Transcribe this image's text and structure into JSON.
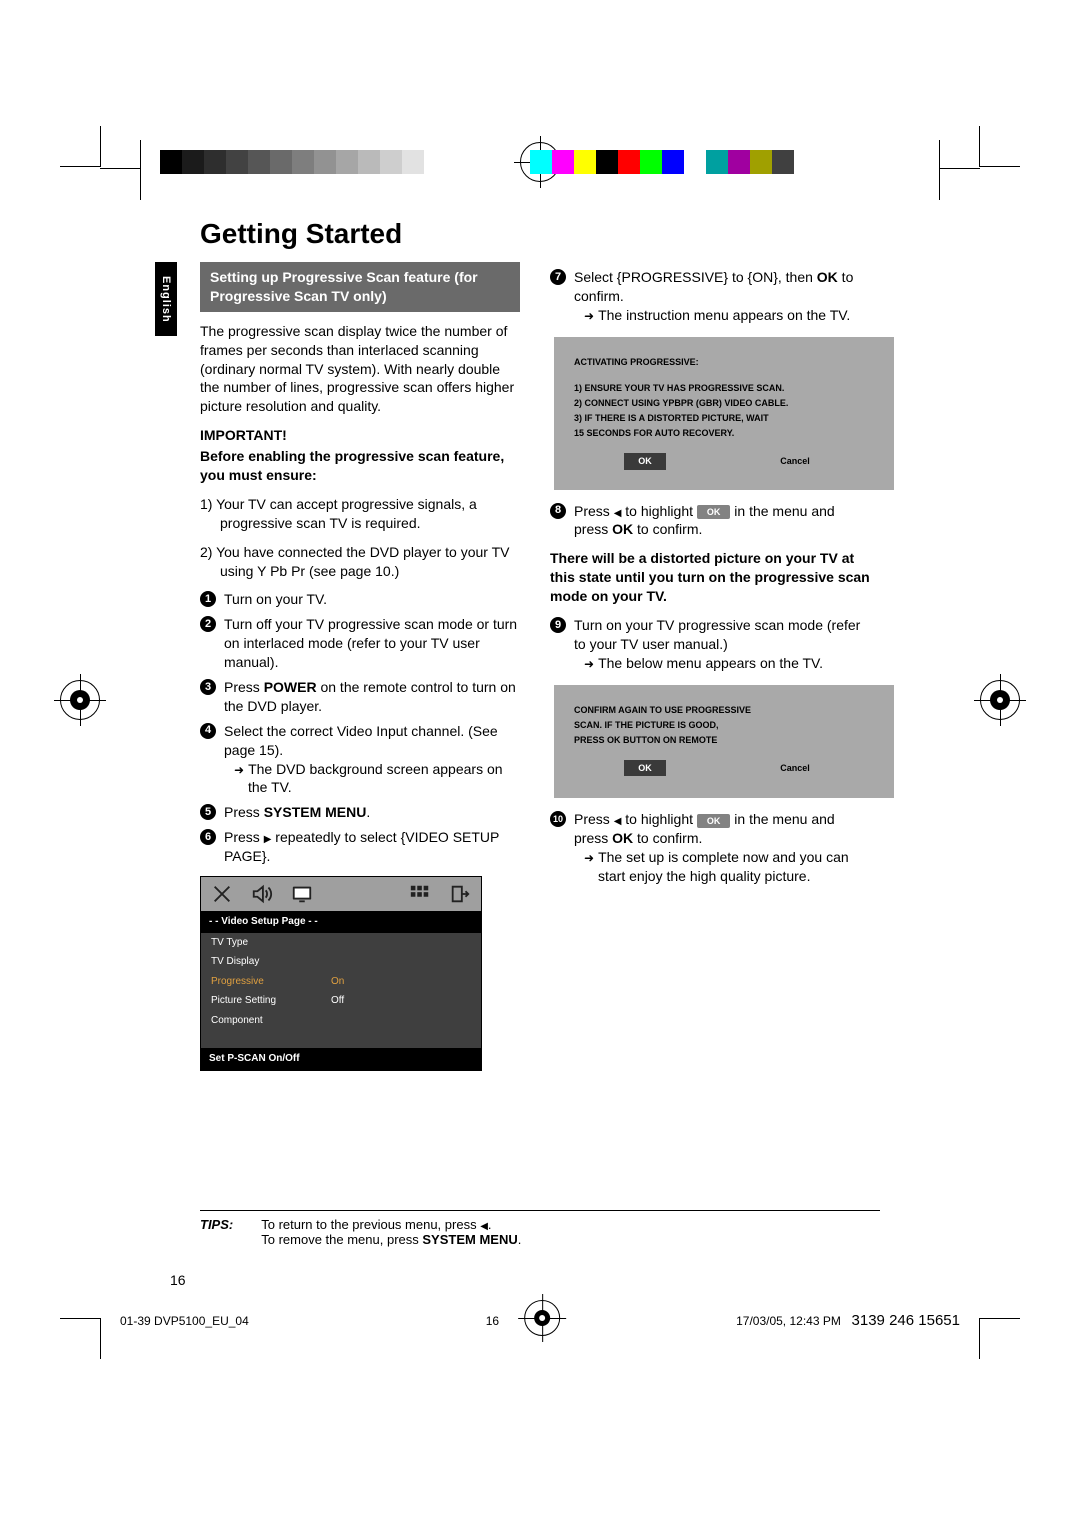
{
  "lang_tab": "English",
  "title": "Getting Started",
  "section_header": "Setting up Progressive Scan feature (for Progressive Scan TV only)",
  "intro": "The progressive scan display twice the number of frames per seconds than interlaced scanning (ordinary normal TV system). With nearly double the number of lines, progressive scan offers higher picture resolution and quality.",
  "important_label": "IMPORTANT!",
  "important_body": "Before enabling the progressive scan feature, you must ensure:",
  "ensure_1": "1) Your TV can accept progressive signals, a progressive scan TV is required.",
  "ensure_2": "2) You have connected the DVD player to your TV using Y Pb Pr (see page 10.)",
  "steps_left": {
    "s1": "Turn on your TV.",
    "s2": "Turn off your TV progressive scan mode or turn on interlaced mode (refer to your TV user manual).",
    "s3_a": "Press ",
    "s3_b": "POWER",
    "s3_c": " on the remote control to turn on the DVD player.",
    "s4_a": "Select the correct Video Input channel. (See page 15).",
    "s4_arrow": "The DVD background screen appears on the TV.",
    "s5_a": "Press ",
    "s5_b": "SYSTEM MENU",
    "s5_c": ".",
    "s6_a": "Press ",
    "s6_b": " repeatedly to select {VIDEO SETUP PAGE}."
  },
  "osd": {
    "title": "- -   Video Setup Page   - -",
    "rows": [
      {
        "label": "TV Type",
        "value": ""
      },
      {
        "label": "TV Display",
        "value": ""
      },
      {
        "label": "Progressive",
        "value": "On",
        "hl": true
      },
      {
        "label": "Picture Setting",
        "value": "Off"
      },
      {
        "label": "Component",
        "value": ""
      }
    ],
    "footer": "Set P-SCAN On/Off"
  },
  "steps_right": {
    "s7_a": "Select {PROGRESSIVE} to {ON}, then ",
    "s7_b": "OK",
    "s7_c": " to confirm.",
    "s7_arrow": "The instruction menu appears on the TV.",
    "dialog1": {
      "l0": "ACTIVATING PROGRESSIVE:",
      "l1": "1) ENSURE YOUR TV HAS PROGRESSIVE SCAN.",
      "l2": "2) CONNECT USING YPBPR (GBR) VIDEO CABLE.",
      "l3": "3) IF THERE IS A DISTORTED PICTURE, WAIT",
      "l4": "    15 SECONDS FOR AUTO RECOVERY.",
      "ok": "OK",
      "cancel": "Cancel"
    },
    "s8_a": "Press ",
    "s8_b": " to highlight ",
    "s8_c": " in the menu and press ",
    "s8_d": "OK",
    "s8_e": " to confirm.",
    "ok_pill": "OK",
    "distort": "There will be a distorted picture on your TV at this state until you turn on the progressive scan mode on your TV.",
    "s9_a": "Turn on your TV progressive scan mode (refer to your TV user manual.)",
    "s9_arrow": "The below menu appears on the TV.",
    "dialog2": {
      "l0": "CONFIRM AGAIN TO USE PROGRESSIVE",
      "l1": "SCAN.  IF THE PICTURE IS GOOD,",
      "l2": "PRESS OK BUTTON ON REMOTE",
      "ok": "OK",
      "cancel": "Cancel"
    },
    "s10_a": "Press ",
    "s10_b": " to highlight ",
    "s10_c": " in the menu and press ",
    "s10_d": "OK",
    "s10_e": " to confirm.",
    "s10_arrow": "The set up is complete now and you can start enjoy the high quality picture."
  },
  "tips": {
    "label": "TIPS:",
    "line1_a": "To return to the previous menu, press ",
    "line1_b": ".",
    "line2_a": "To remove the menu, press ",
    "line2_b": "SYSTEM MENU",
    "line2_c": "."
  },
  "page_number": "16",
  "footer": {
    "left": "01-39 DVP5100_EU_04",
    "mid": "16",
    "right_date": "17/03/05, 12:43 PM",
    "right_num": "3139 246 15651"
  },
  "gray_swatches": [
    "#000000",
    "#1b1b1b",
    "#2e2e2e",
    "#424242",
    "#565656",
    "#6a6a6a",
    "#7e7e7e",
    "#929292",
    "#a6a6a6",
    "#bababa",
    "#cecece",
    "#e2e2e2",
    "#ffffff"
  ],
  "color_swatches": [
    "#00ffff",
    "#ff00ff",
    "#ffff00",
    "#000000",
    "#ff0000",
    "#00ff00",
    "#0000ff",
    "#ffffff",
    "#00a0a0",
    "#a000a0",
    "#a0a000",
    "#404040"
  ]
}
